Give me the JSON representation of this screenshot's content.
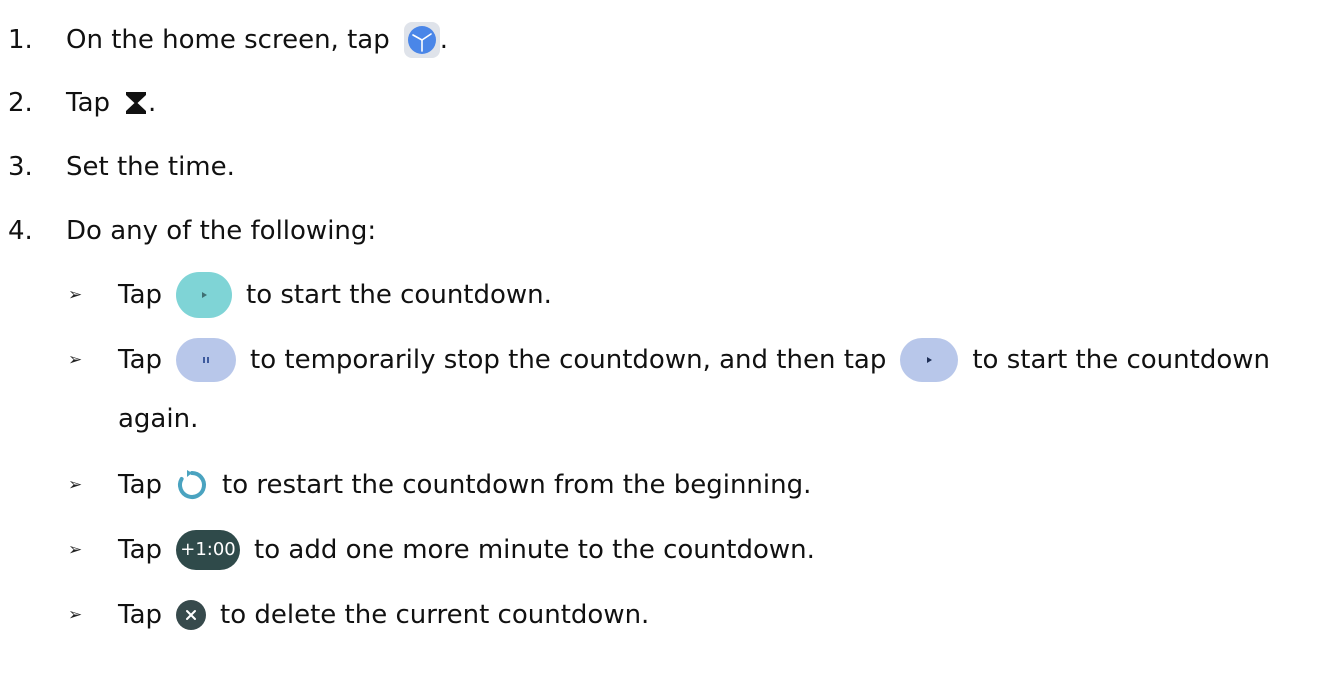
{
  "steps": [
    {
      "num": "1.",
      "before": "On the home screen, tap",
      "after": ".",
      "icon": "clock-app-icon"
    },
    {
      "num": "2.",
      "before": "Tap",
      "after": ".",
      "icon": "hourglass-icon"
    },
    {
      "num": "3.",
      "text": "Set the time."
    },
    {
      "num": "4.",
      "text": "Do any of the following:"
    }
  ],
  "bullet_symbol": "➢",
  "subitems": [
    {
      "tap": "Tap",
      "icon": "play-icon",
      "text": "to start the countdown."
    },
    {
      "tap": "Tap",
      "icon": "pause-icon",
      "text_1": "to temporarily stop the countdown, and then tap",
      "icon_2": "play-icon",
      "text_2": "to start the countdown",
      "continuation": "again."
    },
    {
      "tap": "Tap",
      "icon": "restart-icon",
      "text": "to restart the countdown from the beginning."
    },
    {
      "tap": "Tap",
      "icon": "add-minute-icon",
      "icon_label": "+1:00",
      "text": "to add one more minute to the countdown."
    },
    {
      "tap": "Tap",
      "icon": "delete-icon",
      "text": "to delete the current countdown."
    }
  ],
  "colors": {
    "clock_blue": "#4a86e8",
    "play_teal": "#7fd4d6",
    "pill_blue": "#b8c7ea",
    "restart_teal": "#4aa3c0",
    "dark_slate": "#2f4a4a"
  }
}
